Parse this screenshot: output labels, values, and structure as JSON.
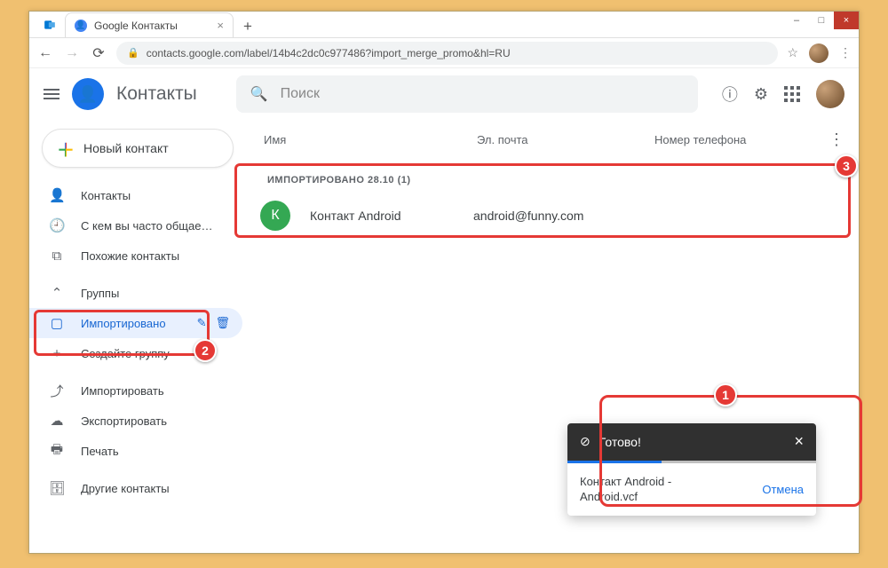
{
  "window": {
    "min": "–",
    "max": "□",
    "close": "×"
  },
  "tab": {
    "title": "Google Контакты",
    "close": "×",
    "new": "+"
  },
  "addr": {
    "back": "←",
    "fwd": "→",
    "reload": "⟳",
    "url": "contacts.google.com/label/14b4c2dc0c977486?import_merge_promo&hl=RU",
    "star": "☆",
    "menu": "⋮"
  },
  "header": {
    "title": "Контакты",
    "search_placeholder": "Поиск"
  },
  "newContact": "Новый контакт",
  "sidebar": {
    "items": [
      {
        "icon": "person",
        "label": "Контакты"
      },
      {
        "icon": "clock",
        "label": "С кем вы часто общае…"
      },
      {
        "icon": "copy",
        "label": "Похожие контакты"
      }
    ],
    "groupsHeader": {
      "label": "Группы",
      "chev": "⌃"
    },
    "activeLabel": {
      "icon": "label",
      "label": "Импортировано",
      "edit": "✎",
      "delete": "🗑"
    },
    "createGroup": {
      "icon": "+",
      "label": "Создайте группу"
    },
    "tools": [
      {
        "icon": "upload",
        "label": "Импортировать"
      },
      {
        "icon": "download",
        "label": "Экспортировать"
      },
      {
        "icon": "print",
        "label": "Печать"
      }
    ],
    "other": {
      "icon": "archive",
      "label": "Другие контакты"
    }
  },
  "columns": {
    "name": "Имя",
    "email": "Эл. почта",
    "phone": "Номер телефона"
  },
  "groupTitle": "ИМПОРТИРОВАНО 28.10 (1)",
  "contacts": [
    {
      "initial": "К",
      "name": "Контакт Android",
      "email": "android@funny.com"
    }
  ],
  "toast": {
    "title": "Готово!",
    "msg": "Контакт Android -\nAndroid.vcf",
    "cancel": "Отмена"
  },
  "badges": {
    "b1": "1",
    "b2": "2",
    "b3": "3"
  }
}
